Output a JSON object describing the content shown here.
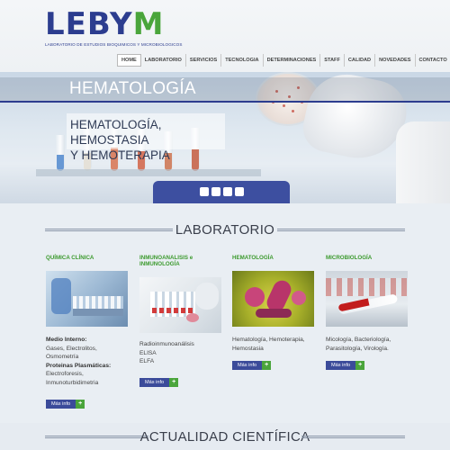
{
  "brand": {
    "name_main": "LEBY",
    "name_accent": "M",
    "tagline": "LABORATORIO DE ESTUDIOS BIOQUIMICOS Y MICROBIOLOGICOS"
  },
  "nav": {
    "items": [
      {
        "label": "HOME",
        "active": true
      },
      {
        "label": "LABORATORIO"
      },
      {
        "label": "SERVICIOS"
      },
      {
        "label": "TECNOLOGIA"
      },
      {
        "label": "DETERMINACIONES"
      },
      {
        "label": "STAFF"
      },
      {
        "label": "CALIDAD"
      },
      {
        "label": "NOVEDADES"
      },
      {
        "label": "CONTACTO"
      }
    ]
  },
  "hero": {
    "title": "HEMATOLOGÍA",
    "subtitle_line1": "HEMATOLOGÍA, HEMOSTASIA",
    "subtitle_line2": "Y HEMOTERAPIA",
    "slides": 4
  },
  "section_lab": {
    "title": "LABORATORIO"
  },
  "columns": [
    {
      "title_line1": "QUÍMICA CLÍNICA",
      "title_line2": "",
      "lines": [
        {
          "text": "Medio Interno:",
          "bold": true
        },
        {
          "text": "Gases, Electrolitos,"
        },
        {
          "text": "Osmometría"
        },
        {
          "text": "Proteinas Plasmáticas:",
          "bold": true
        },
        {
          "text": "Electroforesis,"
        },
        {
          "text": "Inmunoturbidimetria"
        }
      ],
      "button": "Más info"
    },
    {
      "title_line1": "INMUNOANALISIS e",
      "title_line2": "INMUNOLOGÍA",
      "lines": [
        {
          "text": "Radioinmunoanálisis"
        },
        {
          "text": "ELISA"
        },
        {
          "text": "ELFA"
        }
      ],
      "button": "Más info"
    },
    {
      "title_line1": "HEMATOLOGÍA",
      "title_line2": "",
      "lines": [
        {
          "text": "Hematología, Hemoterapia,"
        },
        {
          "text": "Hemostasia"
        }
      ],
      "button": "Más info"
    },
    {
      "title_line1": "MICROBIOLOGÍA",
      "title_line2": "",
      "lines": [
        {
          "text": "Micología, Bacteriología,"
        },
        {
          "text": "Parasitología, Virología."
        }
      ],
      "button": "Más info"
    }
  ],
  "button_plus": "+",
  "section_news": {
    "title": "ACTUALIDAD CIENTÍFICA"
  },
  "colors": {
    "brand_blue": "#2c3d8f",
    "brand_green": "#4aa53b",
    "button_blue": "#3b4b9a"
  }
}
